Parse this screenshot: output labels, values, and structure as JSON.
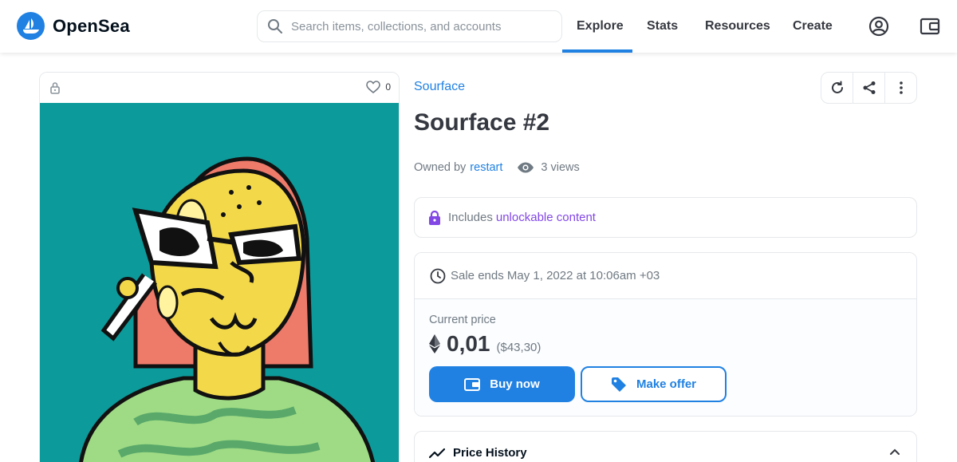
{
  "header": {
    "brand": "OpenSea",
    "search_placeholder": "Search items, collections, and accounts",
    "nav": [
      "Explore",
      "Stats",
      "Resources",
      "Create"
    ],
    "active_nav": "Explore"
  },
  "item": {
    "favorites": "0",
    "collection": "Sourface",
    "title": "Sourface #2",
    "owned_by_label": "Owned by",
    "owner": "restart",
    "views": "3 views"
  },
  "unlockable": {
    "prefix": "Includes",
    "link": "unlockable content"
  },
  "sale": {
    "ends": "Sale ends May 1, 2022 at 10:06am +03",
    "current_price_label": "Current price",
    "price": "0,01",
    "usd": "($43,30)",
    "buy_label": "Buy now",
    "offer_label": "Make offer"
  },
  "price_history": {
    "label": "Price History"
  },
  "colors": {
    "brand_blue": "#2081e2",
    "unlock_purple": "#8247e5",
    "art_bg": "#0d9a9a"
  }
}
